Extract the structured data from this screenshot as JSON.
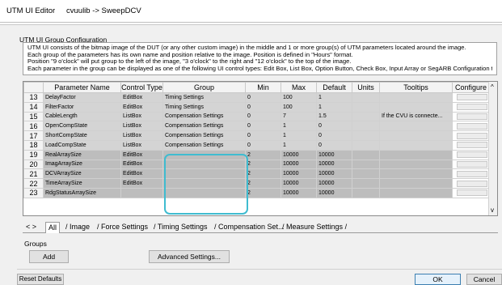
{
  "window": {
    "app_title": "UTM UI Editor",
    "path": "cvuulib -> SweepDCV"
  },
  "config": {
    "group_title": "UTM UI Group Configuration",
    "description": [
      "UTM UI consists of the bitmap image of the DUT (or any other custom image) in the middle and 1 or more group(s) of UTM parameters located around the image.",
      "Each group of the parameters has its own name and position relative to the image. Position is defined in \"Hours\" format.",
      "Position \"9 o'clock\" will put group to the left of the image, \"3 o'clock\" to the right and \"12 o'clock\" to the top of the image.",
      "Each parameter in the group can be displayed as one of the following UI control types: Edit Box, List Box, Option Button, Check Box, Input Array or SegARB Configuration type."
    ]
  },
  "grid": {
    "columns": [
      "",
      "Parameter Name",
      "Control Type",
      "Group",
      "Min",
      "Max",
      "Default",
      "Units",
      "Tooltips",
      "Configure"
    ],
    "rows": [
      {
        "num": "13",
        "name": "DelayFactor",
        "control": "EditBox",
        "group": "Timing Settings",
        "min": "0",
        "max": "100",
        "default": "1",
        "units": "",
        "tooltip": ""
      },
      {
        "num": "14",
        "name": "FilterFactor",
        "control": "EditBox",
        "group": "Timing Settings",
        "min": "0",
        "max": "100",
        "default": "1",
        "units": "",
        "tooltip": ""
      },
      {
        "num": "15",
        "name": "CableLength",
        "control": "ListBox",
        "group": "Compensation Settings",
        "min": "0",
        "max": "7",
        "default": "1.5",
        "units": "",
        "tooltip": "If the CVU is connecte..."
      },
      {
        "num": "16",
        "name": "OpenCompState",
        "control": "ListBox",
        "group": "Compensation Settings",
        "min": "0",
        "max": "1",
        "default": "0",
        "units": "",
        "tooltip": ""
      },
      {
        "num": "17",
        "name": "ShortCompState",
        "control": "ListBox",
        "group": "Compensation Settings",
        "min": "0",
        "max": "1",
        "default": "0",
        "units": "",
        "tooltip": ""
      },
      {
        "num": "18",
        "name": "LoadCompState",
        "control": "ListBox",
        "group": "Compensation Settings",
        "min": "0",
        "max": "1",
        "default": "0",
        "units": "",
        "tooltip": ""
      },
      {
        "num": "19",
        "name": "RealArraySize",
        "control": "EditBox",
        "group": "",
        "min": "2",
        "max": "10000",
        "default": "10000",
        "units": "",
        "tooltip": ""
      },
      {
        "num": "20",
        "name": "ImagArraySize",
        "control": "EditBox",
        "group": "",
        "min": "2",
        "max": "10000",
        "default": "10000",
        "units": "",
        "tooltip": ""
      },
      {
        "num": "21",
        "name": "DCVArraySize",
        "control": "EditBox",
        "group": "",
        "min": "2",
        "max": "10000",
        "default": "10000",
        "units": "",
        "tooltip": ""
      },
      {
        "num": "22",
        "name": "TimeArraySize",
        "control": "EditBox",
        "group": "",
        "min": "2",
        "max": "10000",
        "default": "10000",
        "units": "",
        "tooltip": ""
      },
      {
        "num": "23",
        "name": "RdgStatusArraySize",
        "control": "",
        "group": "",
        "min": "2",
        "max": "10000",
        "default": "10000",
        "units": "",
        "tooltip": ""
      }
    ]
  },
  "tabs": {
    "nav": "< >",
    "items": [
      "All",
      "Image",
      "Force Settings",
      "Timing Settings",
      "Compensation Set...",
      "Measure Settings"
    ]
  },
  "groups": {
    "label": "Groups",
    "add": "Add",
    "advanced": "Advanced Settings..."
  },
  "footer": {
    "reset": "Reset Defaults",
    "ok": "OK",
    "cancel": "Cancel"
  },
  "colors": {
    "highlight": "#3fbcd0",
    "cell_gray": "#d4d4d4"
  }
}
